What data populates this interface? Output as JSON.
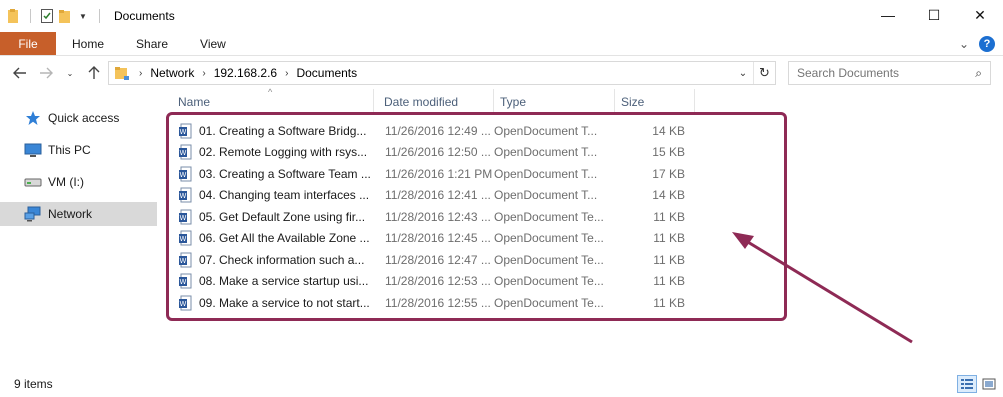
{
  "window": {
    "title": "Documents",
    "minimize_glyph": "—",
    "maximize_glyph": "☐",
    "close_glyph": "✕"
  },
  "ribbon": {
    "tabs": [
      "File",
      "Home",
      "Share",
      "View"
    ]
  },
  "address": {
    "path": [
      "Network",
      "192.168.2.6",
      "Documents"
    ]
  },
  "search": {
    "placeholder": "Search Documents"
  },
  "sidebar": {
    "items": [
      {
        "label": "Quick access",
        "icon": "star-icon"
      },
      {
        "label": "This PC",
        "icon": "computer-icon"
      },
      {
        "label": "VM (I:)",
        "icon": "drive-icon"
      },
      {
        "label": "Network",
        "icon": "network-icon",
        "selected": true
      }
    ]
  },
  "columns": [
    "Name",
    "Date modified",
    "Type",
    "Size"
  ],
  "files": [
    {
      "name": "01. Creating a Software Bridg...",
      "date": "11/26/2016 12:49 ...",
      "type": "OpenDocument T...",
      "size": "14 KB"
    },
    {
      "name": "02. Remote Logging with rsys...",
      "date": "11/26/2016 12:50 ...",
      "type": "OpenDocument T...",
      "size": "15 KB"
    },
    {
      "name": "03. Creating a Software Team ...",
      "date": "11/26/2016 1:21 PM",
      "type": "OpenDocument T...",
      "size": "17 KB"
    },
    {
      "name": "04. Changing team interfaces ...",
      "date": "11/28/2016 12:41 ...",
      "type": "OpenDocument T...",
      "size": "14 KB"
    },
    {
      "name": "05. Get Default Zone using fir...",
      "date": "11/28/2016 12:43 ...",
      "type": "OpenDocument Te...",
      "size": "11 KB"
    },
    {
      "name": "06. Get All the Available Zone ...",
      "date": "11/28/2016 12:45 ...",
      "type": "OpenDocument Te...",
      "size": "11 KB"
    },
    {
      "name": "07. Check information such a...",
      "date": "11/28/2016 12:47 ...",
      "type": "OpenDocument Te...",
      "size": "11 KB"
    },
    {
      "name": "08. Make a service startup usi...",
      "date": "11/28/2016 12:53 ...",
      "type": "OpenDocument Te...",
      "size": "11 KB"
    },
    {
      "name": "09. Make a service to not start...",
      "date": "11/28/2016 12:55 ...",
      "type": "OpenDocument Te...",
      "size": "11 KB"
    }
  ],
  "status": {
    "item_count": "9 items"
  },
  "colors": {
    "file_tab": "#c75f2a",
    "annotation": "#8e2a55",
    "selected_nav": "#d9d9d9"
  }
}
